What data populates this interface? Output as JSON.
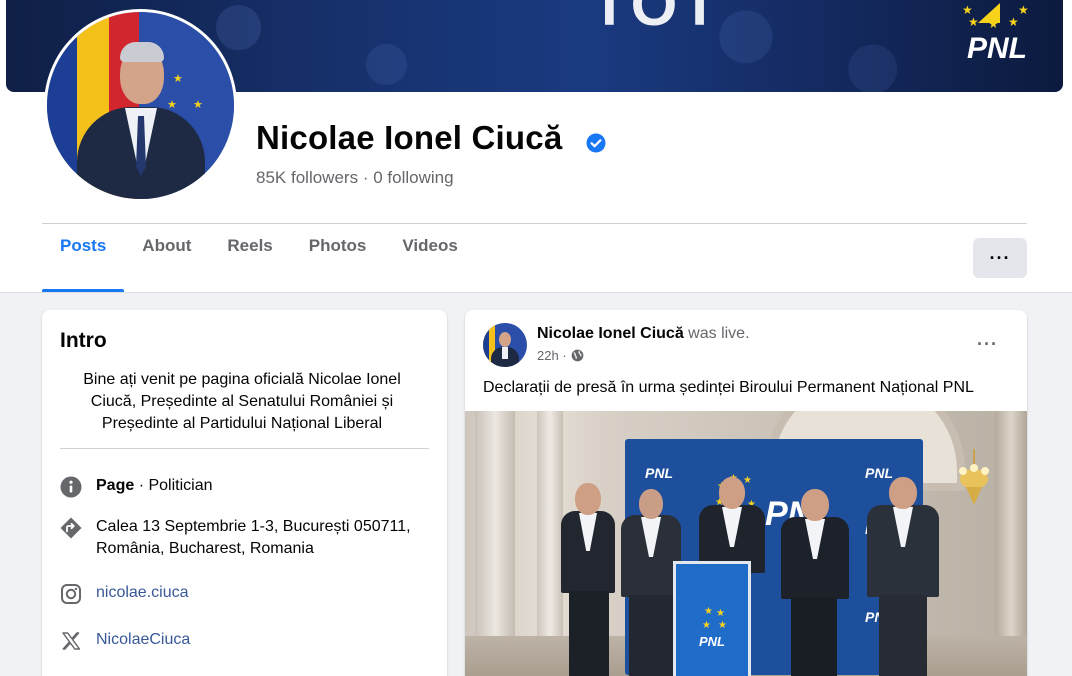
{
  "cover": {
    "big_text": "TOT",
    "logo_text": "PNL"
  },
  "profile": {
    "name": "Nicolae Ionel Ciucă",
    "followers_count": "85K",
    "followers_label": "followers",
    "separator": "·",
    "following_count": "0",
    "following_label": "following",
    "verified": true
  },
  "tabs": [
    {
      "label": "Posts",
      "active": true
    },
    {
      "label": "About",
      "active": false
    },
    {
      "label": "Reels",
      "active": false
    },
    {
      "label": "Photos",
      "active": false
    },
    {
      "label": "Videos",
      "active": false
    }
  ],
  "more_button": "···",
  "intro": {
    "title": "Intro",
    "bio": "Bine ați venit pe pagina oficială Nicolae Ionel Ciucă, Președinte al Senatului României și Președinte al Partidului Național Liberal",
    "page_type_bold": "Page",
    "page_type_rest": " · Politician",
    "address_line1": "Calea 13 Septembrie 1-3, București 050711,",
    "address_line2": "România, Bucharest, Romania",
    "instagram": "nicolae.ciuca",
    "x_handle": "NicolaeCiuca"
  },
  "post": {
    "author": "Nicolae Ionel Ciucă",
    "action": "was live.",
    "time": "22h",
    "separator": "·",
    "menu": "···",
    "text": "Declarații de presă în urma ședinței Biroului Permanent Național PNL",
    "image_logo_big": "PNL",
    "image_logo_small": "PNL",
    "podium_text": "PNL"
  },
  "colors": {
    "accent": "#1877f2",
    "link": "#385898",
    "secondary_text": "#65676b",
    "background": "#f0f2f5",
    "pnl_blue": "#1e4f9c",
    "pnl_yellow": "#f4d11e"
  }
}
